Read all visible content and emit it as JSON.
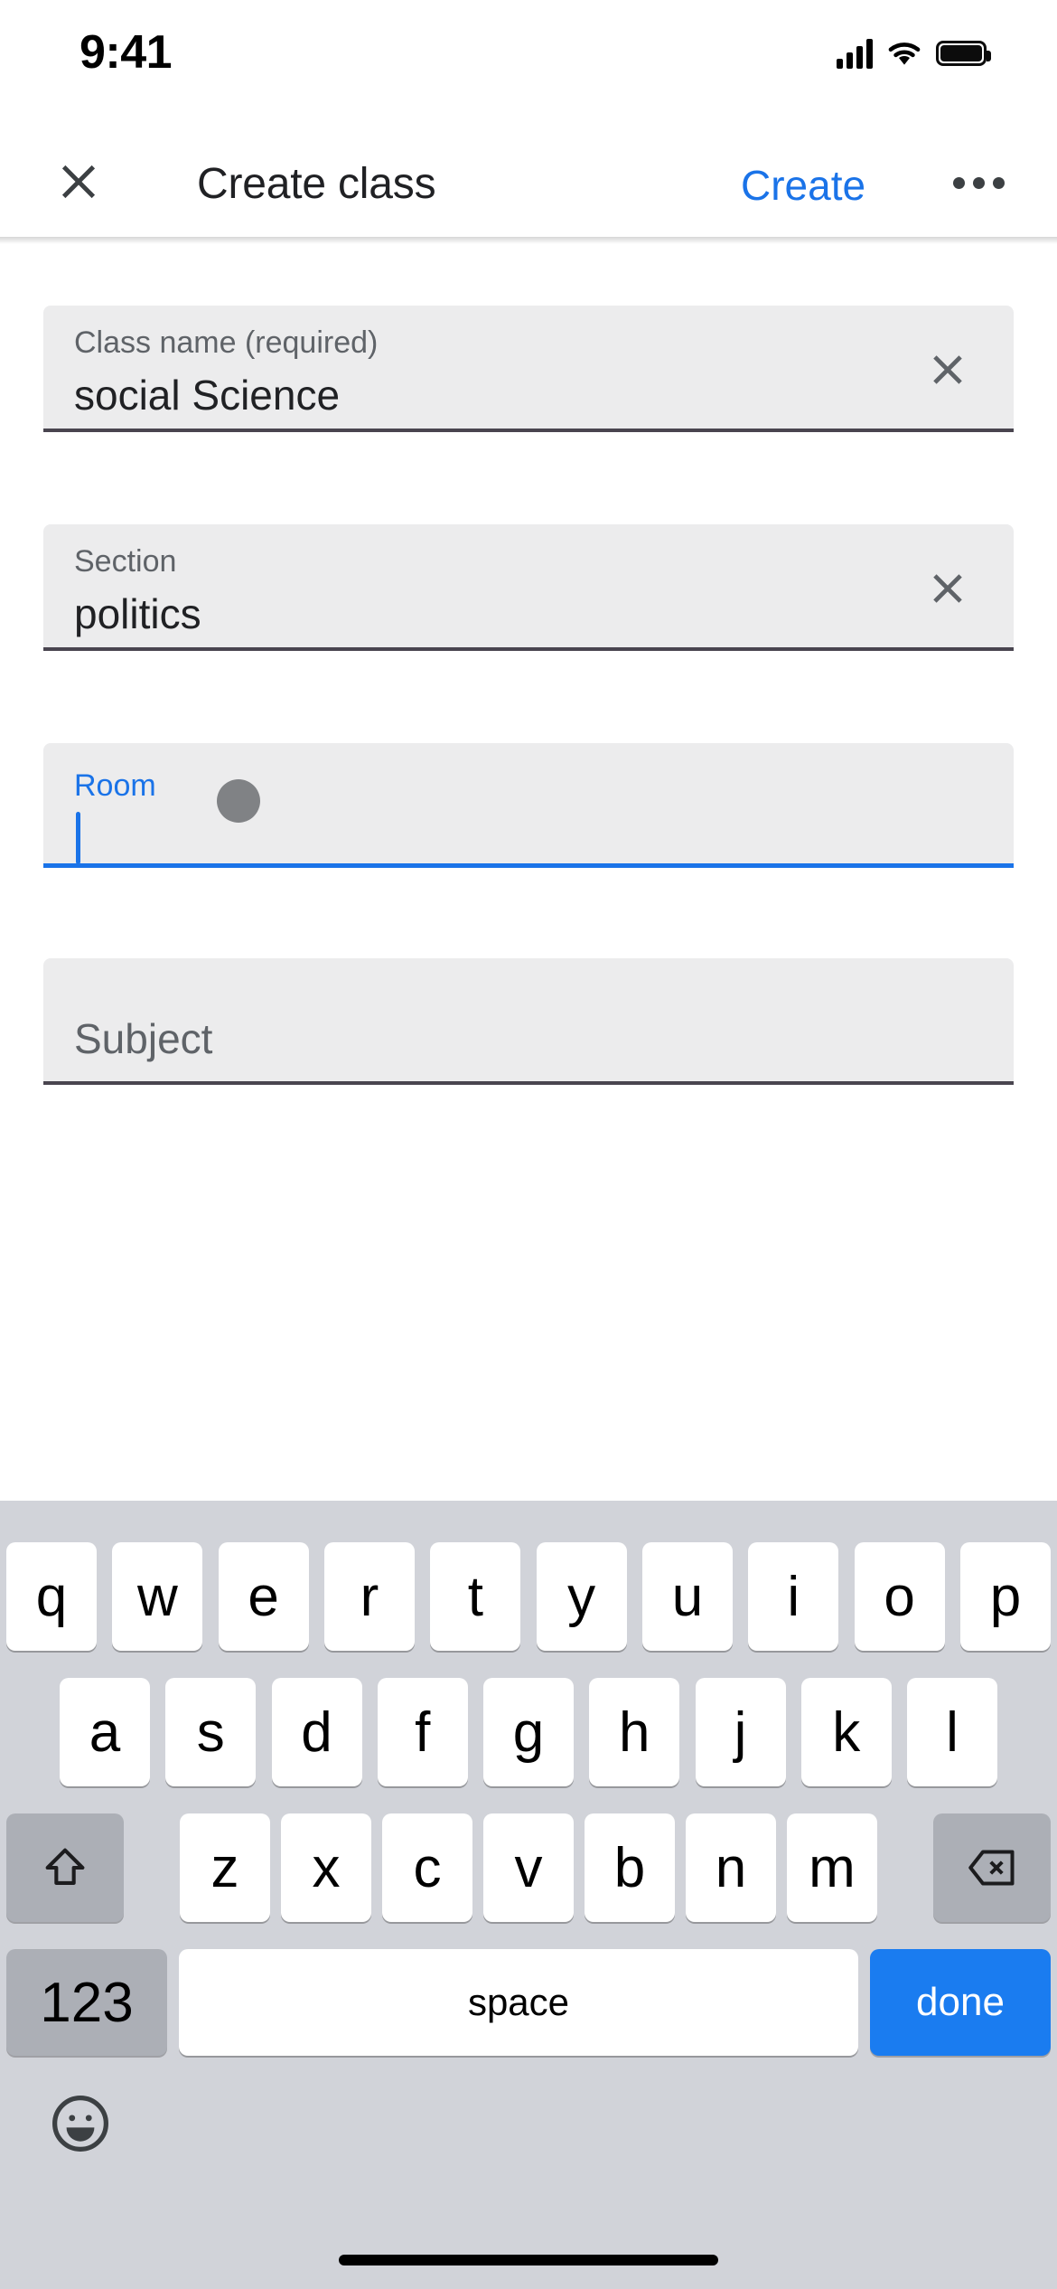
{
  "status_bar": {
    "time": "9:41",
    "icons": [
      "cellular-signal-icon",
      "wifi-icon",
      "battery-icon"
    ]
  },
  "nav_bar": {
    "close_label": "close-icon",
    "title": "Create class",
    "create_label": "Create",
    "more_label": "overflow-menu-icon",
    "accent_color": "#1a73e8"
  },
  "form": {
    "fields": [
      {
        "name": "class-name",
        "label": "Class name (required)",
        "value": "social Science",
        "has_clear": true,
        "focused": false
      },
      {
        "name": "section",
        "label": "Section",
        "value": "politics",
        "has_clear": true,
        "focused": false
      },
      {
        "name": "room",
        "label": "Room",
        "value": "",
        "has_clear": false,
        "focused": true
      },
      {
        "name": "subject",
        "label": "Subject",
        "value": "",
        "has_clear": false,
        "focused": false
      }
    ]
  },
  "keyboard": {
    "row1": [
      "q",
      "w",
      "e",
      "r",
      "t",
      "y",
      "u",
      "i",
      "o",
      "p"
    ],
    "row2": [
      "a",
      "s",
      "d",
      "f",
      "g",
      "h",
      "j",
      "k",
      "l"
    ],
    "row3_letters": [
      "z",
      "x",
      "c",
      "v",
      "b",
      "n",
      "m"
    ],
    "shift_label": "shift-icon",
    "backspace_label": "backspace-icon",
    "numbers_label": "123",
    "space_label": "space",
    "done_label": "done",
    "emoji_label": "emoji-icon",
    "done_color": "#1a7cf0"
  }
}
